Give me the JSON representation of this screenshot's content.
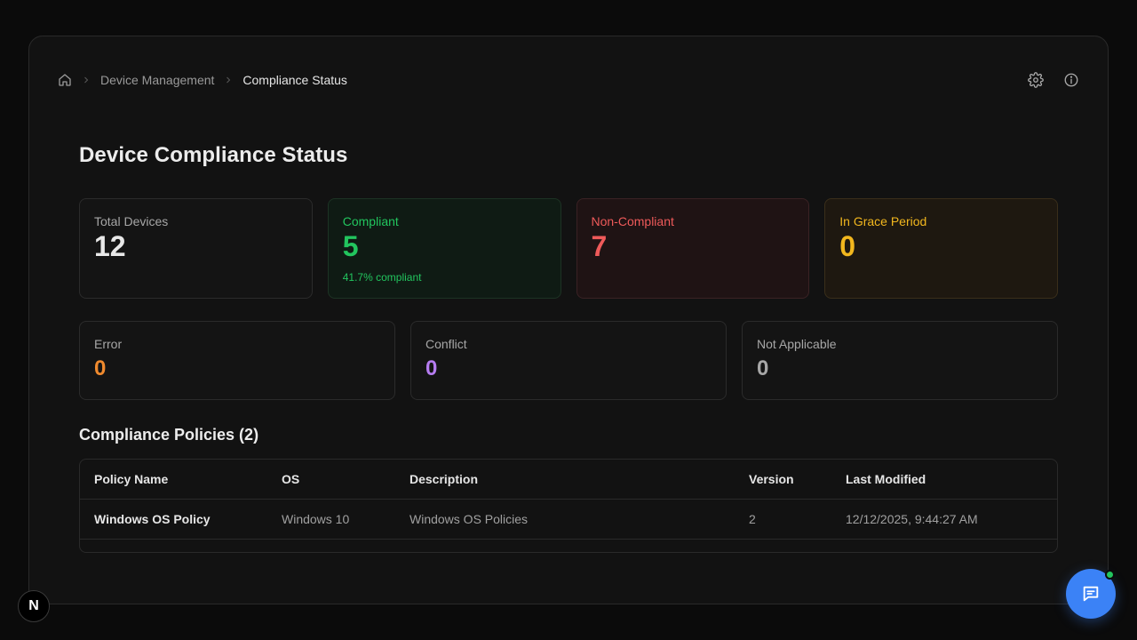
{
  "breadcrumb": {
    "items": [
      "Device Management",
      "Compliance Status"
    ]
  },
  "icons": {
    "home": "home-icon",
    "separator": "chevron-right-icon",
    "settings": "gear-icon",
    "info": "info-icon",
    "chat": "chat-icon"
  },
  "page": {
    "title": "Device Compliance Status"
  },
  "stats": {
    "total": {
      "label": "Total Devices",
      "value": "12"
    },
    "compliant": {
      "label": "Compliant",
      "value": "5",
      "sub": "41.7% compliant"
    },
    "non_compliant": {
      "label": "Non-Compliant",
      "value": "7"
    },
    "grace": {
      "label": "In Grace Period",
      "value": "0"
    },
    "error": {
      "label": "Error",
      "value": "0"
    },
    "conflict": {
      "label": "Conflict",
      "value": "0"
    },
    "not_applicable": {
      "label": "Not Applicable",
      "value": "0"
    }
  },
  "policies": {
    "title": "Compliance Policies (2)",
    "columns": [
      "Policy Name",
      "OS",
      "Description",
      "Version",
      "Last Modified"
    ],
    "rows": [
      {
        "name": "Windows OS Policy",
        "os": "Windows 10",
        "description": "Windows OS Policies",
        "version": "2",
        "modified": "12/12/2025, 9:44:27 AM"
      }
    ]
  },
  "badge": {
    "letter": "N"
  },
  "colors": {
    "compliant": "#22c55e",
    "non_compliant": "#ef5a5a",
    "grace": "#f2b71e",
    "error": "#f08a2e",
    "conflict": "#b57cf0",
    "accent": "#3b82f6"
  }
}
